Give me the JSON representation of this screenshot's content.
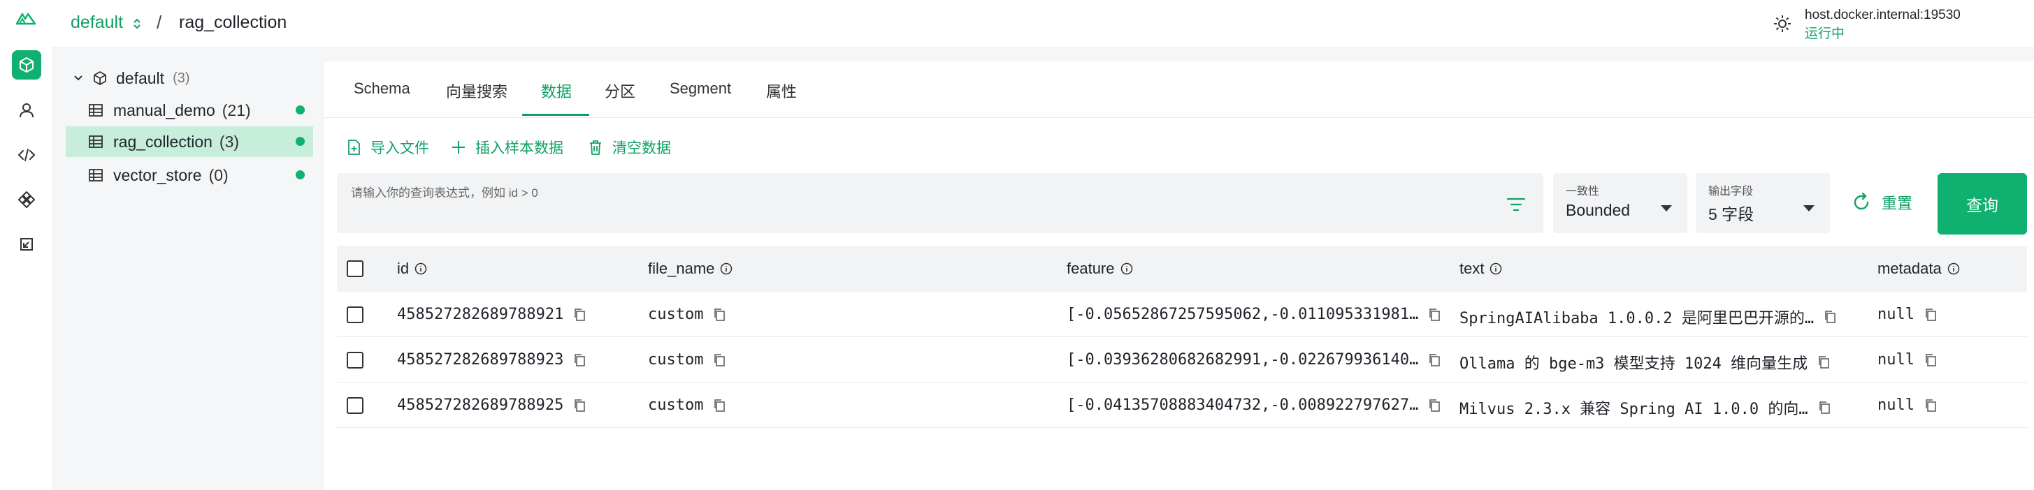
{
  "brand": {
    "accent": "#10b070",
    "accent_text": "#10a065"
  },
  "rail": {
    "items": [
      "collections-icon",
      "user-icon",
      "code-icon",
      "components-icon",
      "import-icon"
    ],
    "active": "collections-icon"
  },
  "topbar": {
    "database": "default",
    "separator": "/",
    "collection": "rag_collection",
    "host": "host.docker.internal:19530",
    "status": "运行中"
  },
  "tree": {
    "root_label": "default",
    "root_count": "(3)",
    "items": [
      {
        "label": "manual_demo",
        "count": "(21)"
      },
      {
        "label": "rag_collection",
        "count": "(3)"
      },
      {
        "label": "vector_store",
        "count": "(0)"
      }
    ],
    "active_index": 1
  },
  "tabs": [
    "Schema",
    "向量搜索",
    "数据",
    "分区",
    "Segment",
    "属性"
  ],
  "active_tab": "数据",
  "actions": {
    "import": "导入文件",
    "insert_sample": "插入样本数据",
    "clear": "清空数据"
  },
  "query": {
    "placeholder": "请输入你的查询表达式，例如 id > 0",
    "consistency_label": "一致性",
    "consistency_value": "Bounded",
    "output_label": "输出字段",
    "output_value": "5 字段",
    "reset": "重置",
    "submit": "查询"
  },
  "table": {
    "columns": [
      "id",
      "file_name",
      "feature",
      "text",
      "metadata"
    ],
    "rows": [
      {
        "id": "458527282689788921",
        "file_name": "custom",
        "feature": "[-0.05652867257595062,-0.011095331981…",
        "text": "SpringAIAlibaba 1.0.0.2 是阿里巴巴开源的…",
        "metadata": "null"
      },
      {
        "id": "458527282689788923",
        "file_name": "custom",
        "feature": "[-0.03936280682682991,-0.022679936140…",
        "text": "Ollama 的 bge-m3 模型支持 1024 维向量生成",
        "metadata": "null"
      },
      {
        "id": "458527282689788925",
        "file_name": "custom",
        "feature": "[-0.04135708883404732,-0.008922797627…",
        "text": "Milvus 2.3.x 兼容 Spring AI 1.0.0 的向…",
        "metadata": "null"
      }
    ]
  }
}
